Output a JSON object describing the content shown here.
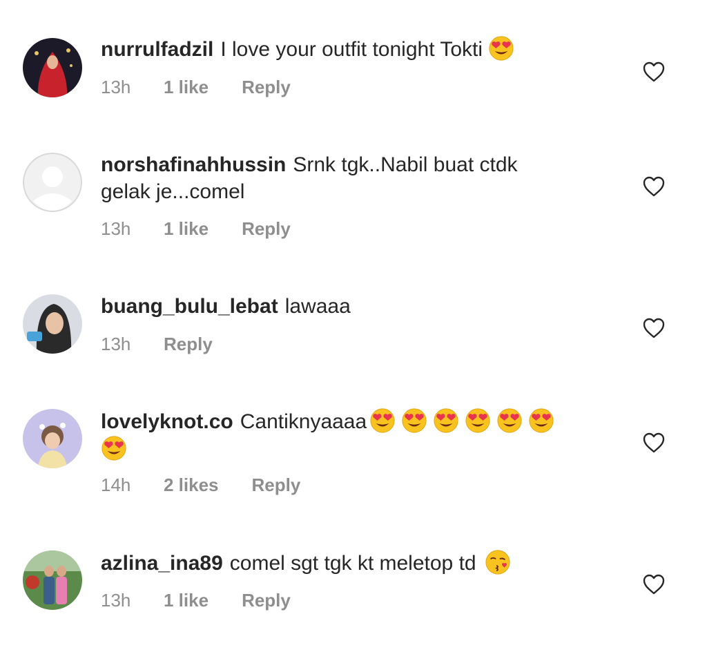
{
  "comments": [
    {
      "username": "nurrulfadzil",
      "text": "I love your outfit tonight Tokti",
      "time": "13h",
      "likes": "1 like",
      "reply": "Reply",
      "emoji": "heart-eyes-icon"
    },
    {
      "username": "norshafinahhussin",
      "text": "Srnk tgk..Nabil buat ctdk",
      "text2": "gelak je...comel",
      "time": "13h",
      "likes": "1 like",
      "reply": "Reply"
    },
    {
      "username": "buang_bulu_lebat",
      "text": "lawaaa",
      "time": "13h",
      "reply": "Reply"
    },
    {
      "username": "lovelyknot.co",
      "text": "Cantiknyaaaa",
      "time": "14h",
      "likes": "2 likes",
      "reply": "Reply",
      "emoji": "heart-eyes-icon",
      "emoji_count": 7
    },
    {
      "username": "azlina_ina89",
      "text": "comel sgt tgk kt meletop td",
      "time": "13h",
      "likes": "1 like",
      "reply": "Reply",
      "emoji": "kissing-face-icon"
    }
  ],
  "colors": {
    "text": "#262626",
    "meta": "#8e8e8e",
    "emoji_face": "#f9c31f",
    "emoji_heart": "#e8344e"
  }
}
